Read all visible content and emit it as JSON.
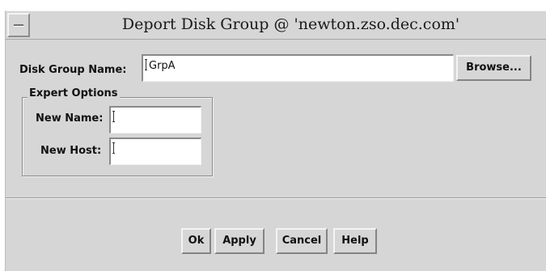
{
  "window": {
    "title": "Deport Disk Group @ 'newton.zso.dec.com'"
  },
  "form": {
    "disk_group_label": "Disk Group Name:",
    "disk_group_value": "GrpA",
    "browse_label": "Browse..."
  },
  "expert": {
    "title": "Expert Options",
    "new_name_label": "New Name:",
    "new_name_value": "",
    "new_host_label": "New Host:",
    "new_host_value": ""
  },
  "buttons": {
    "ok": "Ok",
    "apply": "Apply",
    "cancel": "Cancel",
    "help": "Help"
  },
  "icons": {
    "window_menu": "window-menu-icon"
  }
}
